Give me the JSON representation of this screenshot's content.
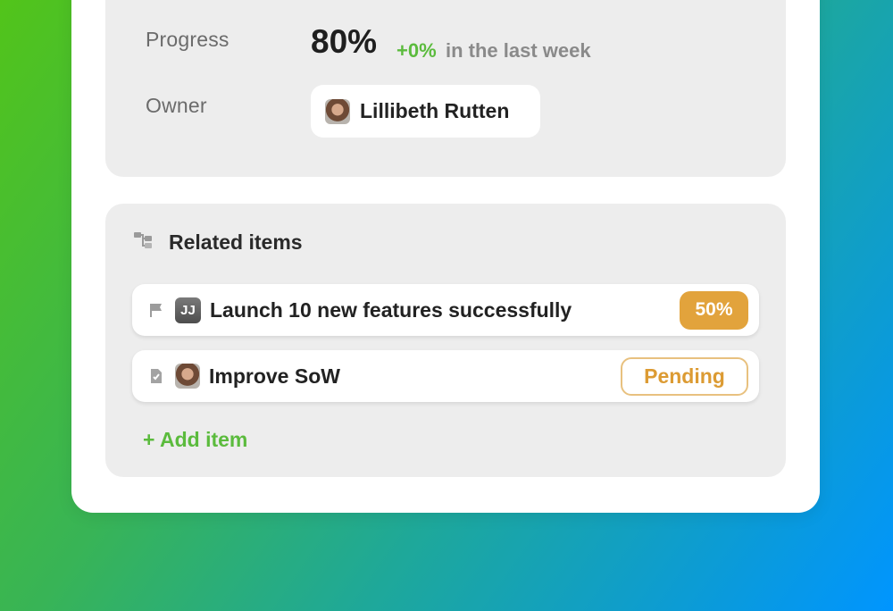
{
  "details": {
    "progress_label": "Progress",
    "progress_value": "80%",
    "progress_delta": "+0%",
    "progress_caption": "in the last week",
    "owner_label": "Owner",
    "owner_name": "Lillibeth Rutten"
  },
  "related": {
    "title": "Related items",
    "icon": "hierarchy-icon",
    "items": [
      {
        "type_icon": "flag-icon",
        "avatar_initials": "JJ",
        "title": "Launch 10 new features successfully",
        "badge": "50%",
        "badge_color": "#e2a33c"
      },
      {
        "type_icon": "task-check-icon",
        "title": "Improve SoW",
        "badge": "Pending",
        "badge_color": "#dc9b33"
      }
    ],
    "add_label": "+ Add item"
  },
  "colors": {
    "accent_green": "#5bbb3d",
    "badge_orange": "#e2a33c"
  }
}
